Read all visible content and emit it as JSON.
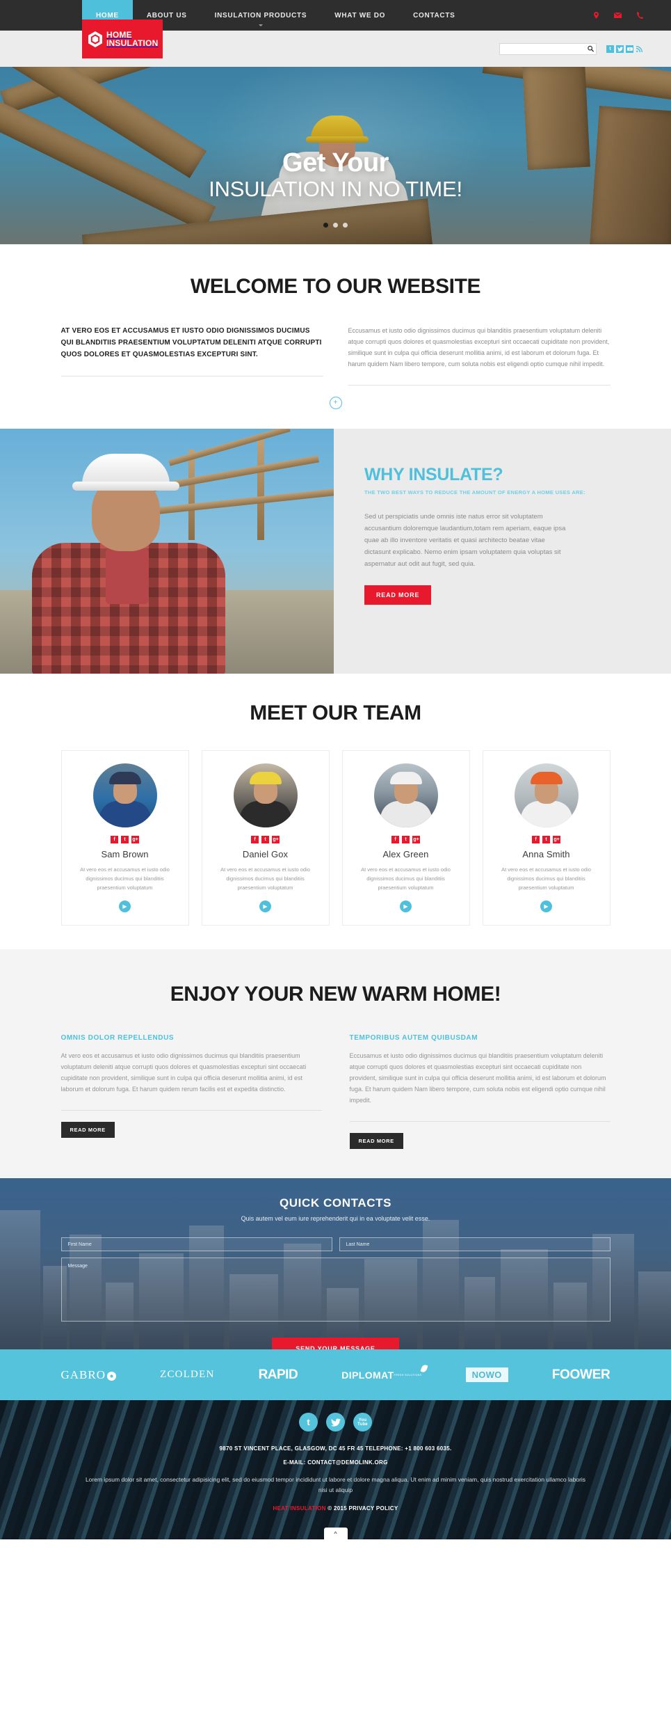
{
  "nav": {
    "items": [
      {
        "label": "HOME",
        "active": true,
        "caret": false
      },
      {
        "label": "ABOUT US",
        "active": false,
        "caret": false
      },
      {
        "label": "INSULATION PRODUCTS",
        "active": false,
        "caret": true
      },
      {
        "label": "WHAT WE DO",
        "active": false,
        "caret": false
      },
      {
        "label": "CONTACTS",
        "active": false,
        "caret": false
      }
    ],
    "contact_icons": [
      "location-pin-icon",
      "envelope-icon",
      "phone-icon"
    ]
  },
  "header": {
    "logo_line1": "HOME",
    "logo_line2": "INSULATION",
    "search_placeholder": "",
    "search_value": "",
    "social": [
      {
        "name": "tumblr",
        "glyph": "t"
      },
      {
        "name": "twitter",
        "glyph": "✆"
      },
      {
        "name": "youtube",
        "glyph": "▶"
      },
      {
        "name": "rss",
        "glyph": "◔"
      }
    ]
  },
  "hero": {
    "line1": "Get Your",
    "line2": "INSULATION IN NO TIME!",
    "slides": 3,
    "active_slide": 1
  },
  "welcome": {
    "title": "WELCOME TO OUR WEBSITE",
    "lead": "AT VERO EOS ET ACCUSAMUS ET IUSTO ODIO DIGNISSIMOS DUCIMUS QUI BLANDITIIS PRAESENTIUM VOLUPTATUM DELENITI ATQUE CORRUPTI QUOS DOLORES ET QUASMOLESTIAS EXCEPTURI SINT.",
    "body": "Eccusamus et iusto odio dignissimos ducimus qui blanditiis praesentium voluptatum deleniti atque corrupti quos dolores et quasmolestias excepturi sint occaecati cupiditate non provident, similique sunt in culpa qui officia deserunt mollitia animi, id est laborum et dolorum fuga. Et harum quidem Nam libero tempore, cum soluta nobis est eligendi optio cumque nihil impedit.",
    "more_icon": "plus-circle-icon"
  },
  "why": {
    "title": "WHY INSULATE?",
    "subtitle": "THE TWO BEST WAYS TO REDUCE THE AMOUNT OF ENERGY A HOME USES ARE:",
    "body": "Sed ut perspiciatis unde omnis iste natus error sit voluptatem accusantium doloremque laudantium,totam rem aperiam, eaque ipsa quae ab illo inventore veritatis et quasi architecto beatae vitae dictasunt explicabo. Nemo enim ipsam voluptatem quia voluptas sit aspernatur aut odit aut fugit, sed quia.",
    "button": "READ MORE"
  },
  "team": {
    "title": "MEET OUR TEAM",
    "social_icons": [
      "facebook-icon",
      "twitter-icon",
      "google-plus-icon"
    ],
    "members": [
      {
        "name": "Sam Brown",
        "desc": "At vero eos et accusamus et iusto odio dignissimos ducimus qui blanditiis praesentium voluptatum"
      },
      {
        "name": "Daniel Gox",
        "desc": "At vero eos et accusamus et iusto odio dignissimos ducimus qui blanditiis praesentium voluptatum"
      },
      {
        "name": "Alex Green",
        "desc": "At vero eos et accusamus et iusto odio dignissimos ducimus qui blanditiis praesentium voluptatum"
      },
      {
        "name": "Anna Smith",
        "desc": "At vero eos et accusamus et iusto odio dignissimos ducimus qui blanditiis praesentium voluptatum"
      }
    ]
  },
  "enjoy": {
    "title": "ENJOY YOUR NEW WARM HOME!",
    "col1_head": "OMNIS DOLOR REPELLENDUS",
    "col1_body": "At vero eos et accusamus et iusto odio dignissimos ducimus qui blanditiis praesentium voluptatum deleniti atque corrupti quos dolores et quasmolestias excepturi sint occaecati cupiditate non provident, similique sunt in culpa qui officia deserunt mollitia animi, id est laborum et dolorum fuga. Et harum quidem rerum facilis est et expedita distinctio.",
    "col1_button": "READ MORE",
    "col2_head": "TEMPORIBUS AUTEM QUIBUSDAM",
    "col2_body": "Eccusamus et iusto odio dignissimos ducimus qui blanditiis praesentium voluptatum deleniti atque corrupti quos dolores et quasmolestias excepturi sint occaecati cupiditate non provident, similique sunt in culpa qui officia deserunt mollitia animi, id est laborum et dolorum fuga. Et harum quidem Nam libero tempore, cum soluta nobis est eligendi optio cumque nihil impedit.",
    "col2_button": "READ MORE"
  },
  "quick_contacts": {
    "title": "QUICK CONTACTS",
    "subtitle": "Quis autem vel eum iure reprehenderit qui in ea voluptate velit esse.",
    "first_name_placeholder": "First Name",
    "first_name_value": "",
    "last_name_placeholder": "Last Name",
    "last_name_value": "",
    "message_placeholder": "Message",
    "message_value": "",
    "submit": "SEND YOUR MESSAGE"
  },
  "brands": [
    {
      "name": "GABRO"
    },
    {
      "name": "ZCOLDEN"
    },
    {
      "name": "RAPID"
    },
    {
      "name": "DIPLOMAT",
      "tagline": "FRESH SOLUTIONS"
    },
    {
      "name": "NOWO"
    },
    {
      "name": "FOOWER"
    }
  ],
  "footer": {
    "social": [
      {
        "name": "tumblr",
        "glyph": "t"
      },
      {
        "name": "twitter",
        "glyph": "✆"
      },
      {
        "name": "youtube",
        "glyph": "You"
      }
    ],
    "youtube_line2": "Tube",
    "address": "9870 ST VINCENT PLACE,  GLASGOW, DC 45 FR 45   TELEPHONE:  +1 800 603 6035.",
    "email": "E-MAIL: CONTACT@DEMOLINK.ORG",
    "lorem": "Lorem ipsum dolor sit amet, consectetur adipisicing elit, sed do eiusmod tempor incididunt ut labore et dolore magna aliqua. Ut enim ad minim veniam, quis nostrud exercitation ullamco laboris nisi ut aliquip",
    "copyright_brand": "HEAT INSULATION",
    "copyright_rest": " © 2015  PRIVACY POLICY",
    "to_top_icon": "chevron-up-icon"
  }
}
